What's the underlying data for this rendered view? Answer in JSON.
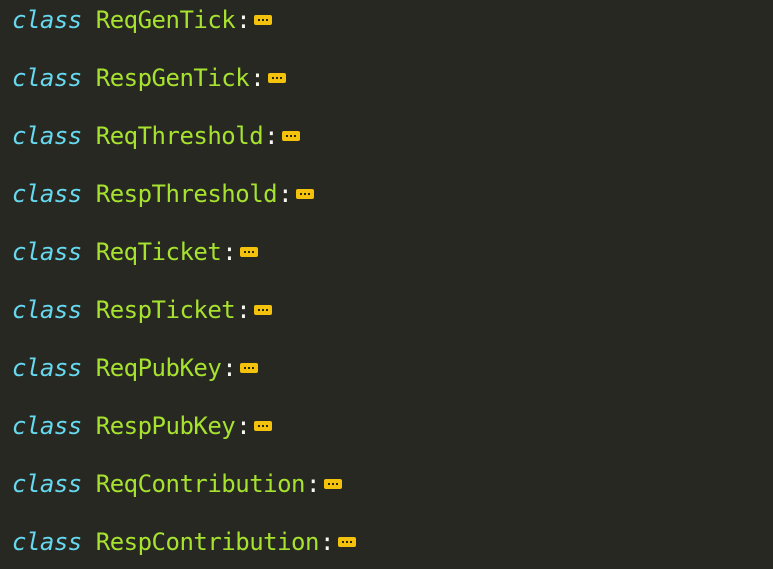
{
  "editor": {
    "keyword": "class",
    "colon": ":",
    "fold_icon": "ellipsis-fold-icon",
    "lines": [
      {
        "name": "ReqGenTick"
      },
      {
        "name": "RespGenTick"
      },
      {
        "name": "ReqThreshold"
      },
      {
        "name": "RespThreshold"
      },
      {
        "name": "ReqTicket"
      },
      {
        "name": "RespTicket"
      },
      {
        "name": "ReqPubKey"
      },
      {
        "name": "RespPubKey"
      },
      {
        "name": "ReqContribution"
      },
      {
        "name": "RespContribution"
      }
    ]
  },
  "colors": {
    "background": "#272822",
    "keyword": "#66d9ef",
    "class_name": "#a6e22e",
    "punctuation": "#f8f8f2",
    "fold_marker": "#f4c20d"
  }
}
